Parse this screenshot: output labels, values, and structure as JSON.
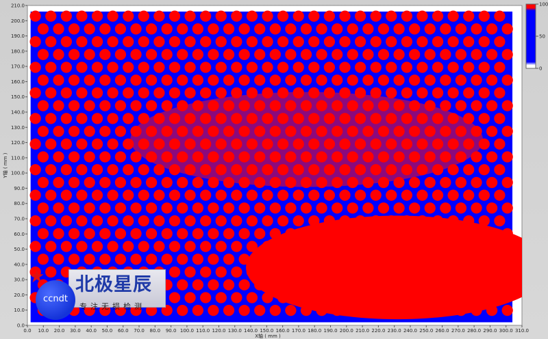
{
  "chart_data": {
    "type": "heatmap",
    "title": "",
    "xlabel": "X轴 ( mm )",
    "ylabel": "Y轴 ( mm )",
    "xlim": [
      0,
      310
    ],
    "ylim": [
      0,
      210
    ],
    "x_ticks": [
      "0.0",
      "10.0",
      "20.0",
      "30.0",
      "40.0",
      "50.0",
      "60.0",
      "70.0",
      "80.0",
      "90.0",
      "100.0",
      "110.0",
      "120.0",
      "130.0",
      "140.0",
      "150.0",
      "160.0",
      "170.0",
      "180.0",
      "190.0",
      "200.0",
      "210.0",
      "220.0",
      "230.0",
      "240.0",
      "250.0",
      "260.0",
      "270.0",
      "280.0",
      "290.0",
      "300.0",
      "310.0"
    ],
    "y_ticks": [
      "0.0",
      "10.0",
      "20.0",
      "30.0",
      "40.0",
      "50.0",
      "60.0",
      "70.0",
      "80.0",
      "90.0",
      "100.0",
      "110.0",
      "120.0",
      "130.0",
      "140.0",
      "150.0",
      "160.0",
      "170.0",
      "180.0",
      "190.0",
      "200.0",
      "210.0"
    ],
    "data_extent": {
      "x": [
        2,
        304
      ],
      "y": [
        2,
        206
      ]
    },
    "dot_pitch_mm": 9.7,
    "color_scale": {
      "ticks": [
        "100",
        "50",
        "0"
      ],
      "stops": [
        {
          "value": 100,
          "color": "#ff0000"
        },
        {
          "value": 50,
          "color": "#0000ff"
        },
        {
          "value": 0,
          "color": "#ffffff"
        }
      ]
    },
    "regions": [
      {
        "label": "dense defect zone (lower-right)",
        "cx": 232,
        "cy": 38,
        "rx": 95,
        "ry": 34,
        "level": 100
      },
      {
        "label": "elevated zone (middle band)",
        "cx": 175,
        "cy": 122,
        "rx": 130,
        "ry": 52,
        "level": 75
      }
    ],
    "background_level": 50
  },
  "watermark": {
    "brand_cn": "北极星辰",
    "brand_en": "ccndt",
    "slogan": "专注无损检测",
    "colors": {
      "brand": "#1f3aa8",
      "star": "#e01010",
      "circle": "#1433d8"
    },
    "icon": "red-star-icon"
  }
}
